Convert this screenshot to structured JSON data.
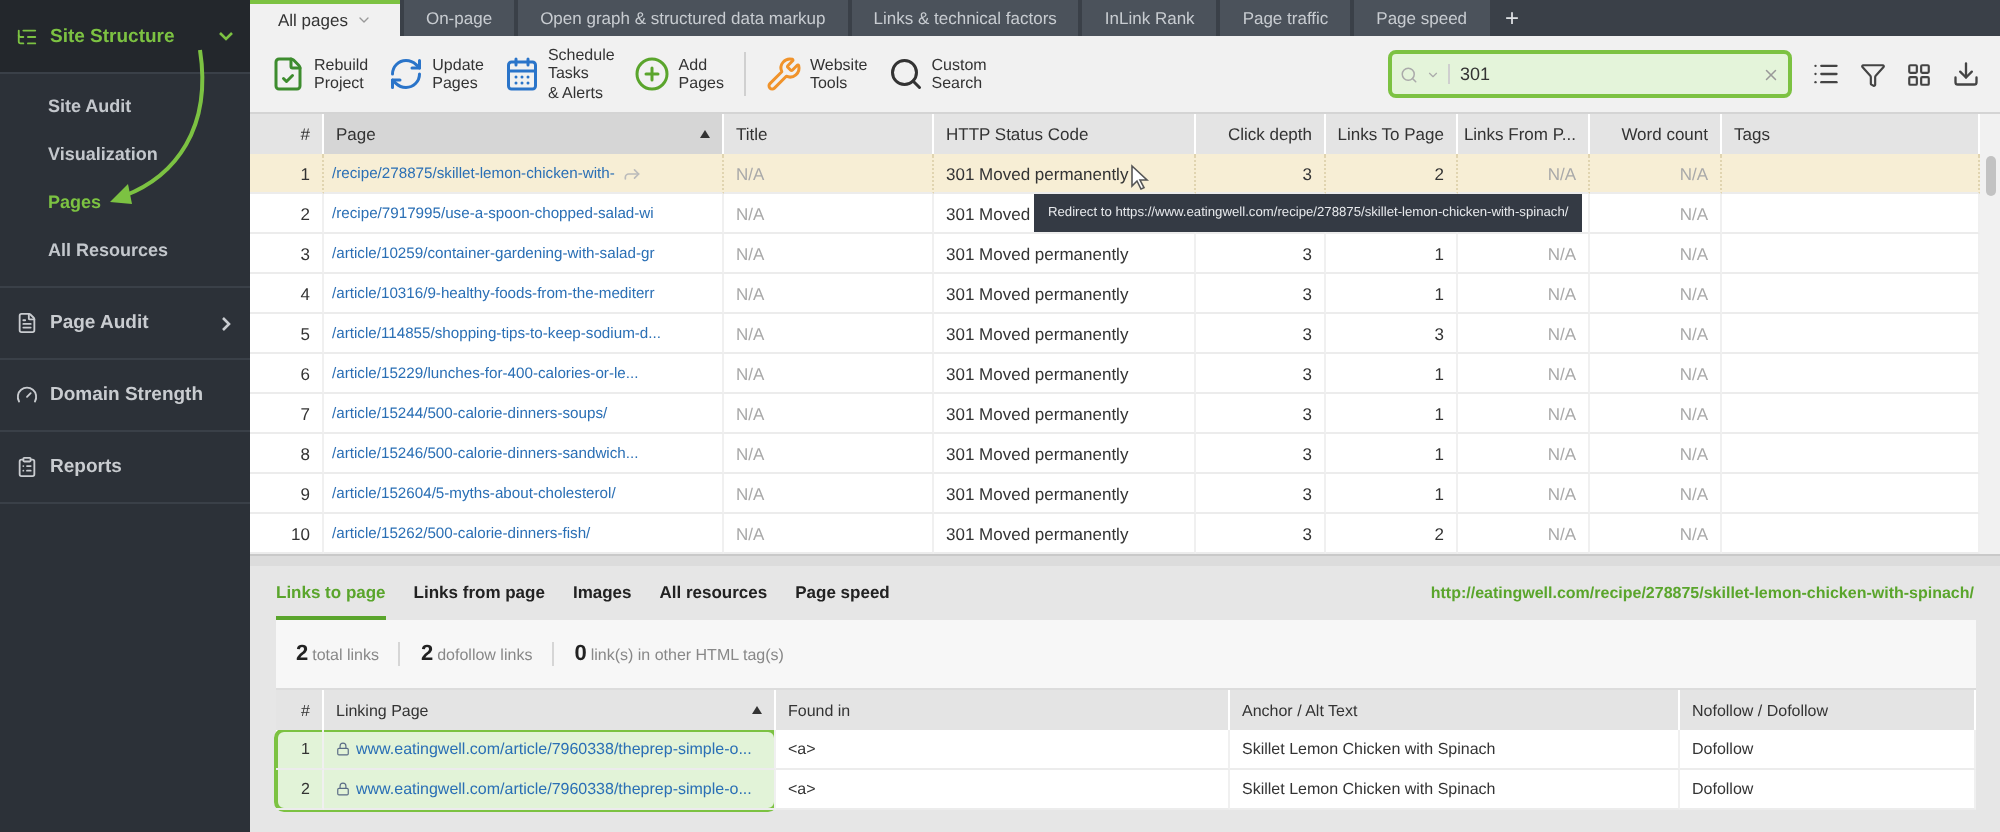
{
  "sidebar": {
    "sections": [
      {
        "label": "Site Structure",
        "expanded": true,
        "selected": true,
        "children": [
          {
            "label": "Site Audit",
            "selected": false
          },
          {
            "label": "Visualization",
            "selected": false
          },
          {
            "label": "Pages",
            "selected": true
          },
          {
            "label": "All Resources",
            "selected": false
          }
        ]
      },
      {
        "label": "Page Audit",
        "expanded": false,
        "selected": false
      },
      {
        "label": "Domain Strength",
        "selected": false
      },
      {
        "label": "Reports",
        "selected": false
      }
    ]
  },
  "tabs": [
    {
      "label": "All pages",
      "selected": true
    },
    {
      "label": "On-page",
      "selected": false
    },
    {
      "label": "Open graph & structured data markup",
      "selected": false
    },
    {
      "label": "Links & technical factors",
      "selected": false
    },
    {
      "label": "InLink Rank",
      "selected": false
    },
    {
      "label": "Page traffic",
      "selected": false
    },
    {
      "label": "Page speed",
      "selected": false
    }
  ],
  "add_tab": "+",
  "toolbar": [
    {
      "label": "Rebuild\nProject"
    },
    {
      "label": "Update\nPages"
    },
    {
      "label": "Schedule\nTasks\n& Alerts"
    },
    {
      "label": "Add\nPages"
    },
    {
      "label": "Website\nTools"
    },
    {
      "label": "Custom\nSearch"
    }
  ],
  "search": {
    "value": "301"
  },
  "table": {
    "columns": [
      "#",
      "Page",
      "Title",
      "HTTP Status Code",
      "Click depth",
      "Links To Page",
      "Links From P...",
      "Word count",
      "Tags"
    ],
    "rows": [
      {
        "selected": true,
        "cells": [
          "1",
          "/recipe/278875/skillet-lemon-chicken-with-",
          "N/A",
          "301 Moved permanently",
          "3",
          "2",
          "N/A",
          "N/A",
          ""
        ]
      },
      {
        "selected": false,
        "cells": [
          "2",
          "/recipe/7917995/use-a-spoon-chopped-salad-wi",
          "N/A",
          "301 Moved",
          "",
          "",
          "",
          "N/A",
          ""
        ]
      },
      {
        "selected": false,
        "cells": [
          "3",
          "/article/10259/container-gardening-with-salad-gr",
          "N/A",
          "301 Moved permanently",
          "3",
          "1",
          "N/A",
          "N/A",
          ""
        ]
      },
      {
        "selected": false,
        "cells": [
          "4",
          "/article/10316/9-healthy-foods-from-the-mediterr",
          "N/A",
          "301 Moved permanently",
          "3",
          "1",
          "N/A",
          "N/A",
          ""
        ]
      },
      {
        "selected": false,
        "cells": [
          "5",
          "/article/114855/shopping-tips-to-keep-sodium-d...",
          "N/A",
          "301 Moved permanently",
          "3",
          "3",
          "N/A",
          "N/A",
          ""
        ]
      },
      {
        "selected": false,
        "cells": [
          "6",
          "/article/15229/lunches-for-400-calories-or-le...",
          "N/A",
          "301 Moved permanently",
          "3",
          "1",
          "N/A",
          "N/A",
          ""
        ]
      },
      {
        "selected": false,
        "cells": [
          "7",
          "/article/15244/500-calorie-dinners-soups/",
          "N/A",
          "301 Moved permanently",
          "3",
          "1",
          "N/A",
          "N/A",
          ""
        ]
      },
      {
        "selected": false,
        "cells": [
          "8",
          "/article/15246/500-calorie-dinners-sandwich...",
          "N/A",
          "301 Moved permanently",
          "3",
          "1",
          "N/A",
          "N/A",
          ""
        ]
      },
      {
        "selected": false,
        "cells": [
          "9",
          "/article/152604/5-myths-about-cholesterol/",
          "N/A",
          "301 Moved permanently",
          "3",
          "1",
          "N/A",
          "N/A",
          ""
        ]
      },
      {
        "selected": false,
        "cells": [
          "10",
          "/article/15262/500-calorie-dinners-fish/",
          "N/A",
          "301 Moved permanently",
          "3",
          "2",
          "N/A",
          "N/A",
          ""
        ]
      }
    ],
    "tooltip": "Redirect to https://www.eatingwell.com/recipe/278875/skillet-lemon-chicken-with-spinach/"
  },
  "details": {
    "tabs": [
      {
        "label": "Links to page",
        "selected": true
      },
      {
        "label": "Links from page",
        "selected": false
      },
      {
        "label": "Images",
        "selected": false
      },
      {
        "label": "All resources",
        "selected": false
      },
      {
        "label": "Page speed",
        "selected": false
      }
    ],
    "url": "http://eatingwell.com/recipe/278875/skillet-lemon-chicken-with-spinach/",
    "summary": [
      {
        "count": "2",
        "label": "total links"
      },
      {
        "count": "2",
        "label": "dofollow links"
      },
      {
        "count": "0",
        "label": "link(s) in other HTML tag(s)"
      }
    ],
    "columns": [
      "#",
      "Linking Page",
      "Found in",
      "Anchor / Alt Text",
      "Nofollow / Dofollow"
    ],
    "rows": [
      {
        "cells": [
          "1",
          "www.eatingwell.com/article/7960338/theprep-simple-o...",
          "<a>",
          "Skillet Lemon Chicken with Spinach",
          "Dofollow"
        ]
      },
      {
        "cells": [
          "2",
          "www.eatingwell.com/article/7960338/theprep-simple-o...",
          "<a>",
          "Skillet Lemon Chicken with Spinach",
          "Dofollow"
        ]
      }
    ]
  }
}
